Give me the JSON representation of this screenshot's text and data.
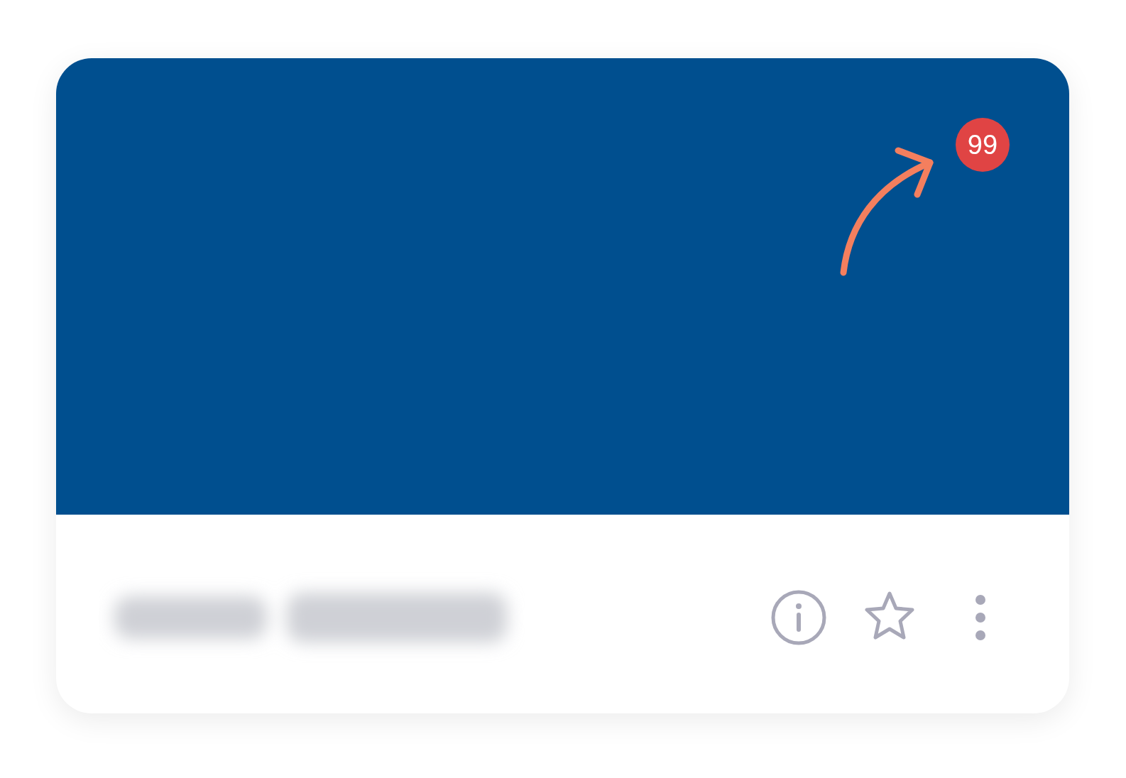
{
  "banner": {
    "badge": {
      "count": "99"
    },
    "annotation_arrow": true
  },
  "footer": {
    "title_blurred": true,
    "actions": [
      {
        "kind": "info"
      },
      {
        "kind": "star"
      },
      {
        "kind": "more"
      }
    ]
  }
}
